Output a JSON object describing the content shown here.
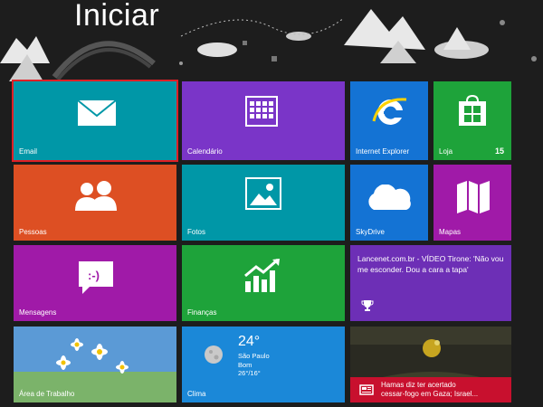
{
  "screen": {
    "title": "Iniciar"
  },
  "colors": {
    "background": "#1d1d1d",
    "teal": "#0097a7",
    "orange": "#dd4f23",
    "purple": "#7a35c8",
    "blue": "#1473d4",
    "green": "#1ea33a",
    "magenta": "#a01aa8",
    "news_purple": "#6d2fb6",
    "selection": "#e01f26"
  },
  "tiles": {
    "email": {
      "label": "Email"
    },
    "calendar": {
      "label": "Calendário"
    },
    "ie": {
      "label": "Internet Explorer"
    },
    "store": {
      "label": "Loja",
      "badge": "15"
    },
    "people": {
      "label": "Pessoas"
    },
    "photos": {
      "label": "Fotos"
    },
    "skydrive": {
      "label": "SkyDrive"
    },
    "maps": {
      "label": "Mapas"
    },
    "messages": {
      "label": "Mensagens"
    },
    "finance": {
      "label": "Finanças"
    },
    "news": {
      "text": "Lancenet.com.br - VÍDEO Tirone: 'Não vou me esconder. Dou a cara a tapa'"
    },
    "desktop": {
      "label": "Área de Trabalho"
    },
    "weather": {
      "label": "Clima",
      "temp": "24°",
      "city": "São Paulo",
      "condition": "Bom",
      "range": "26°/16°"
    },
    "headline": {
      "line1": "Hamas diz ter acertado",
      "line2": "cessar-fogo em Gaza; Israel..."
    }
  }
}
